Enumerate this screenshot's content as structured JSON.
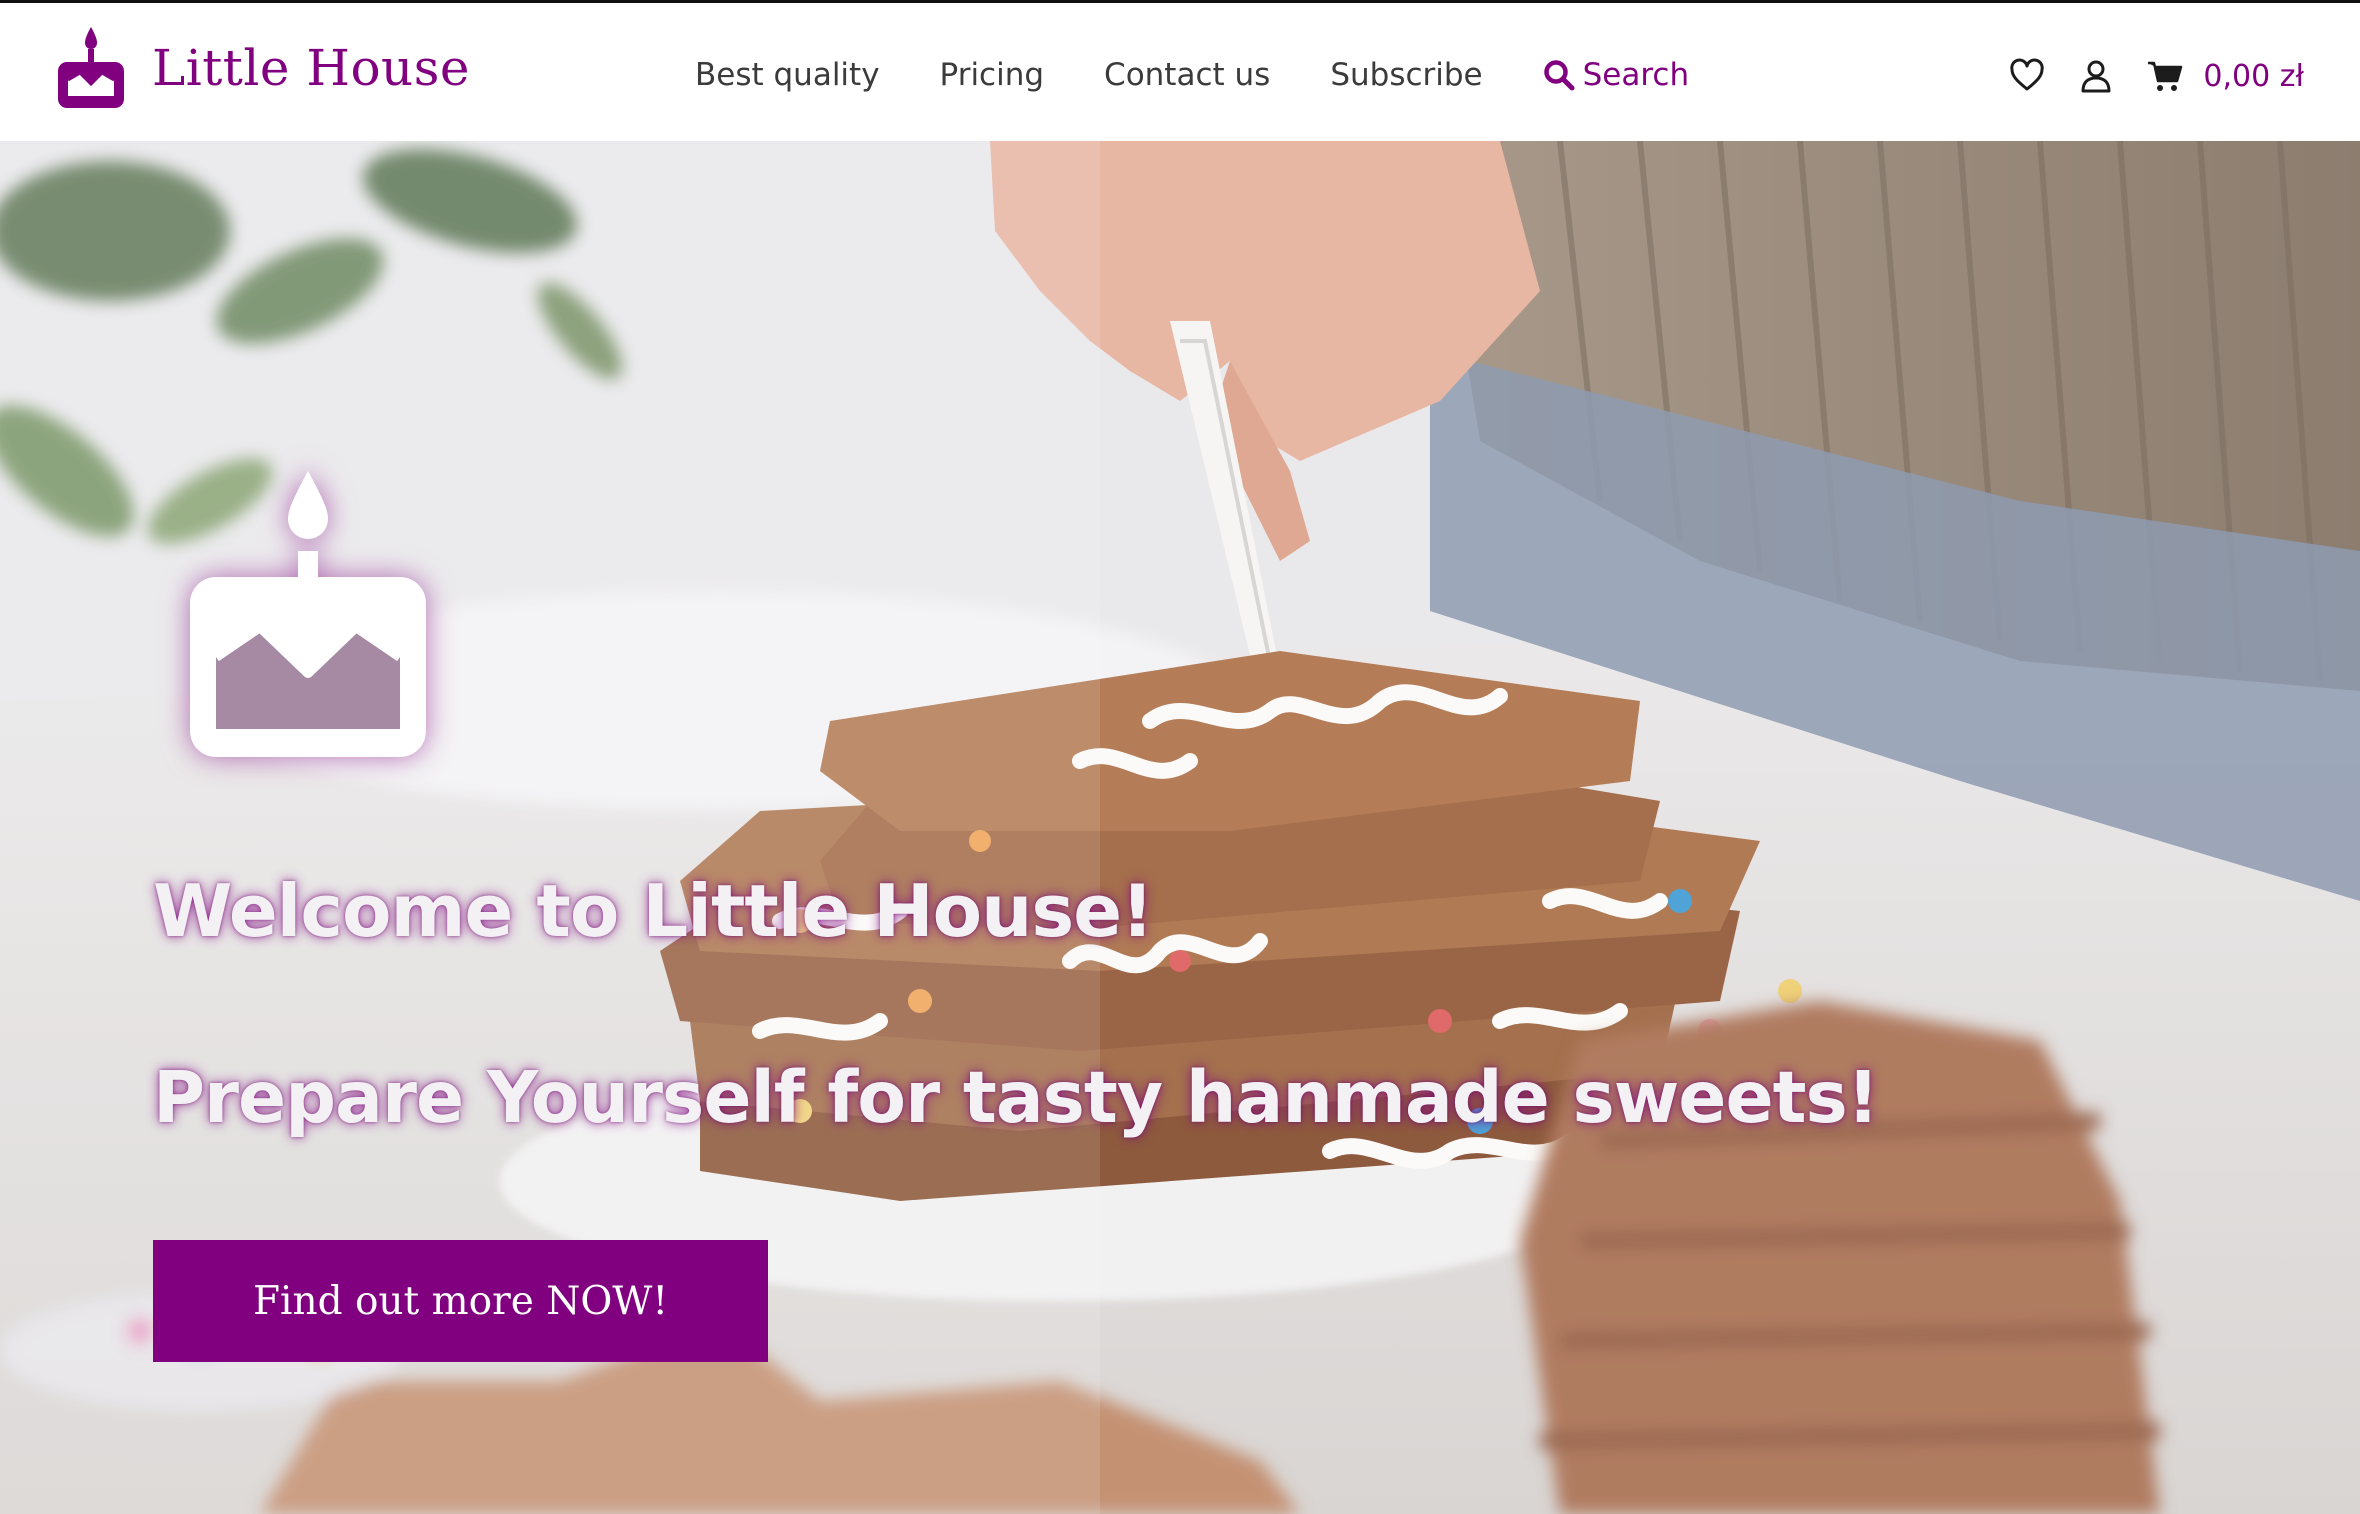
{
  "brand": {
    "name": "Little House",
    "logo_icon": "birthday-cake-icon",
    "accent_color": "#800080"
  },
  "nav": {
    "items": [
      {
        "label": "Best quality"
      },
      {
        "label": "Pricing"
      },
      {
        "label": "Contact us"
      },
      {
        "label": "Subscribe"
      }
    ],
    "search_label": "Search",
    "search_icon": "search-icon"
  },
  "utilities": {
    "wishlist_icon": "heart-icon",
    "account_icon": "user-icon",
    "cart_icon": "cart-icon",
    "cart_total": "0,00 zł"
  },
  "hero": {
    "background": "gingerbread-cookies-icing-photo",
    "logo_icon": "birthday-cake-icon",
    "heading": "Welcome to Little House!",
    "subheading": "Prepare Yourself for tasty hanmade sweets!",
    "cta_label": "Find out more NOW!"
  }
}
